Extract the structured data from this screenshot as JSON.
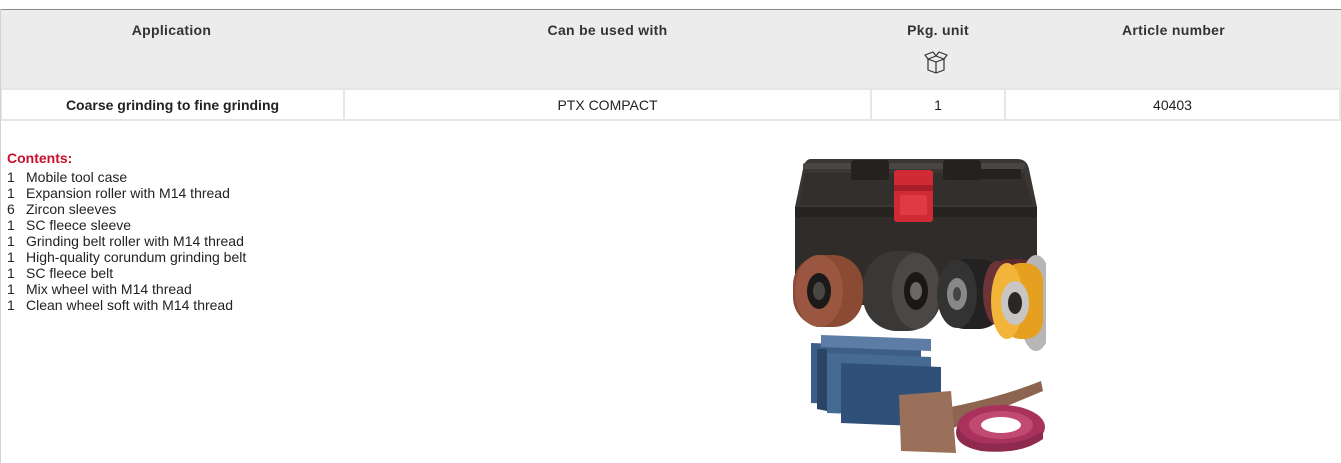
{
  "table": {
    "headers": {
      "application": "Application",
      "can_be_used_with": "Can be used with",
      "pkg_unit": "Pkg. unit",
      "article_number": "Article number"
    },
    "pkg_icon": "open-box-icon",
    "row": {
      "application": "Coarse grinding to fine grinding",
      "can_be_used_with": "PTX COMPACT",
      "pkg_unit": "1",
      "article_number": "40403"
    }
  },
  "contents": {
    "title": "Contents:",
    "items": [
      {
        "qty": "1",
        "name": "Mobile tool case"
      },
      {
        "qty": "1",
        "name": "Expansion roller with M14 thread"
      },
      {
        "qty": "6",
        "name": "Zircon sleeves"
      },
      {
        "qty": "1",
        "name": "SC fleece sleeve"
      },
      {
        "qty": "1",
        "name": "Grinding belt roller with M14 thread"
      },
      {
        "qty": "1",
        "name": "High-quality corundum grinding belt"
      },
      {
        "qty": "1",
        "name": "SC fleece belt"
      },
      {
        "qty": "1",
        "name": "Mix wheel with M14 thread"
      },
      {
        "qty": "1",
        "name": "Clean wheel soft with M14 thread"
      }
    ]
  },
  "colors": {
    "accent_red": "#c8102e",
    "header_bg": "#ececec",
    "case_black": "#2a2826",
    "case_clip_red": "#d02a34"
  },
  "image": {
    "subject": "tool case with grinding rollers, sleeves and belts"
  }
}
